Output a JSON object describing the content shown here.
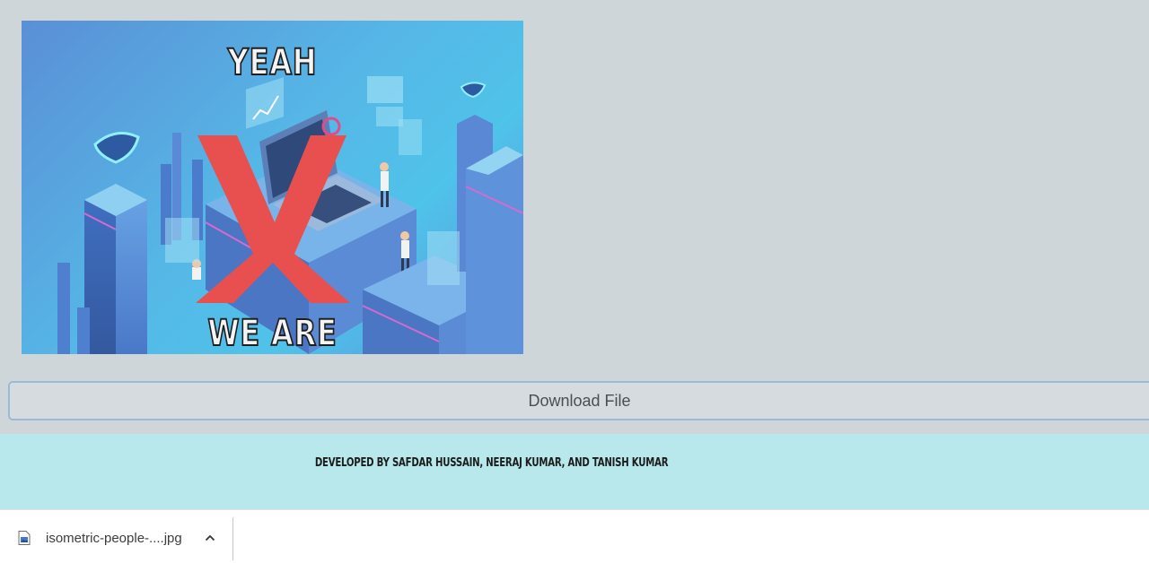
{
  "image": {
    "top_caption": "YEAH",
    "bottom_caption": "WE ARE",
    "overlay_symbol": "X",
    "overlay_color": "#e8504f"
  },
  "download_button": {
    "label": "Download File"
  },
  "footer": {
    "credit": "DEVELOPED BY SAFDAR HUSSAIN, NEERAJ KUMAR, AND TANISH KUMAR",
    "background": "#b8e8ec"
  },
  "download_shelf": {
    "file_name": "isometric-people-....jpg",
    "file_icon": "image-file-icon",
    "menu_icon": "chevron-up-icon"
  },
  "colors": {
    "page_background": "#cfd6da",
    "button_border": "#9cbad6"
  }
}
